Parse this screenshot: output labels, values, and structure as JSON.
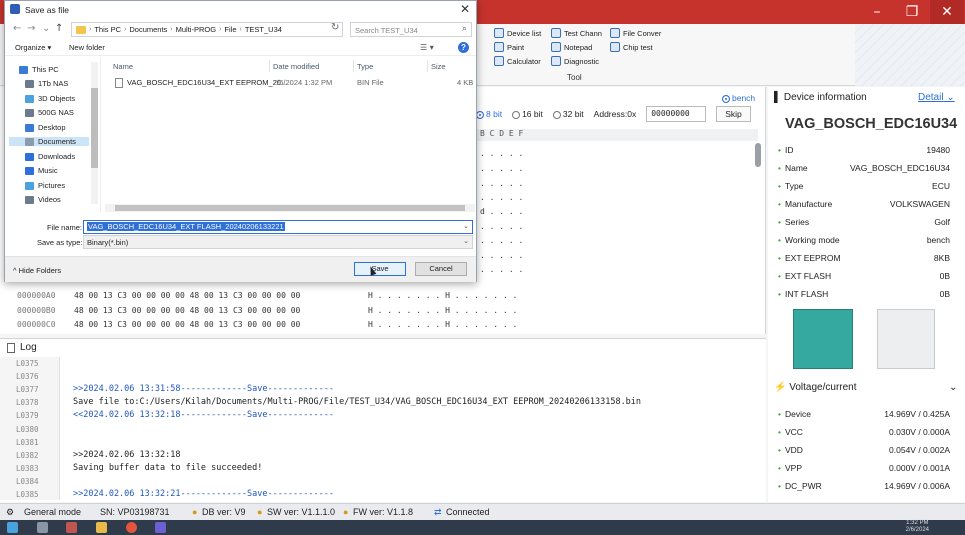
{
  "ribbon": {
    "tools": [
      {
        "label": "Device list"
      },
      {
        "label": "Test Chann"
      },
      {
        "label": "File Conver"
      },
      {
        "label": "Paint"
      },
      {
        "label": "Notepad"
      },
      {
        "label": "Chip test"
      },
      {
        "label": "Calculator"
      },
      {
        "label": "Diagnostic"
      }
    ],
    "group_label": "Tool"
  },
  "hex": {
    "bench_label": "bench",
    "bits": [
      {
        "label": "8 bit",
        "selected": true
      },
      {
        "label": "16 bit",
        "selected": false
      },
      {
        "label": "32 bit",
        "selected": false
      }
    ],
    "address_label": "Address:0x",
    "address_value": "00000000",
    "skip_label": "Skip",
    "header": "B C D E F",
    "partial_rows": [
      ". . . . .",
      ". . . . .",
      ". . . . .",
      ". . . . .",
      "d . . . .",
      ". . . . .",
      ". . . . .",
      ". . . . .",
      ". . . . ."
    ],
    "rows": [
      {
        "addr": "000000A0",
        "bytes": "48 00 13 C3 00 00 00 00 48 00 13 C3 00 00 00 00",
        "ascii": "H . . . . . . . H . . . . . . ."
      },
      {
        "addr": "000000B0",
        "bytes": "48 00 13 C3 00 00 00 00 48 00 13 C3 00 00 00 00",
        "ascii": "H . . . . . . . H . . . . . . ."
      },
      {
        "addr": "000000C0",
        "bytes": "48 00 13 C3 00 00 00 00 48 00 13 C3 00 00 00 00",
        "ascii": "H . . . . . . . H . . . . . . ."
      }
    ]
  },
  "log": {
    "title": "Log",
    "lines": [
      {
        "no": "L0375",
        "text": "",
        "style": ""
      },
      {
        "no": "L0376",
        "text": "",
        "style": ""
      },
      {
        "no": "L0377",
        "text": ">>2024.02.06 13:31:58-------------Save-------------",
        "style": "blue"
      },
      {
        "no": "L0378",
        "text": "Save file to:C:/Users/Kilah/Documents/Multi-PROG/File/TEST_U34/VAG_BOSCH_EDC16U34_EXT EEPROM_20240206133158.bin",
        "style": ""
      },
      {
        "no": "L0379",
        "text": "<<2024.02.06 13:32:18-------------Save-------------",
        "style": "blue"
      },
      {
        "no": "L0380",
        "text": "",
        "style": ""
      },
      {
        "no": "L0381",
        "text": "",
        "style": ""
      },
      {
        "no": "L0382",
        "text": ">>2024.02.06 13:32:18",
        "style": ""
      },
      {
        "no": "L0383",
        "text": "Saving buffer data to file succeeded!",
        "style": ""
      },
      {
        "no": "L0384",
        "text": "",
        "style": ""
      },
      {
        "no": "L0385",
        "text": ">>2024.02.06 13:32:21-------------Save-------------",
        "style": "blue"
      }
    ]
  },
  "device_info": {
    "title": "Device information",
    "detail_label": "Detail",
    "name": "VAG_BOSCH_EDC16U34",
    "fields": [
      {
        "key": "ID",
        "value": "19480"
      },
      {
        "key": "Name",
        "value": "VAG_BOSCH_EDC16U34"
      },
      {
        "key": "Type",
        "value": "ECU"
      },
      {
        "key": "Manufacture",
        "value": "VOLKSWAGEN"
      },
      {
        "key": "Series",
        "value": "Golf"
      },
      {
        "key": "Working mode",
        "value": "bench"
      },
      {
        "key": "EXT EEPROM",
        "value": "8KB"
      },
      {
        "key": "EXT FLASH",
        "value": "0B"
      },
      {
        "key": "INT FLASH",
        "value": "0B"
      }
    ]
  },
  "voltage": {
    "title": "Voltage/current",
    "rows": [
      {
        "key": "Device",
        "value": "14.969V / 0.425A"
      },
      {
        "key": "VCC",
        "value": "0.030V / 0.000A"
      },
      {
        "key": "VDD",
        "value": "0.054V / 0.002A"
      },
      {
        "key": "VPP",
        "value": "0.000V / 0.001A"
      },
      {
        "key": "DC_PWR",
        "value": "14.969V / 0.006A"
      }
    ]
  },
  "status": {
    "mode": "General mode",
    "sn": "SN:  VP03198731",
    "db": "DB ver: V9",
    "sw": "SW ver: V1.1.1.0",
    "fw": "FW ver: V1.1.8",
    "conn": "Connected"
  },
  "taskbar": {
    "time": "1:32 PM",
    "date": "2/6/2024"
  },
  "dialog": {
    "title": "Save as file",
    "breadcrumb": [
      "This PC",
      "Documents",
      "Multi-PROG",
      "File",
      "TEST_U34"
    ],
    "search_placeholder": "Search TEST_U34",
    "organize": "Organize",
    "new_folder": "New folder",
    "nav_items": [
      {
        "label": "This PC",
        "color": "#3a7bd5"
      },
      {
        "label": "1Tb NAS",
        "color": "#6b7b8c"
      },
      {
        "label": "3D Objects",
        "color": "#4aa3df"
      },
      {
        "label": "500G NAS",
        "color": "#6b7b8c"
      },
      {
        "label": "Desktop",
        "color": "#3a7bd5"
      },
      {
        "label": "Documents",
        "color": "#8a9bb0"
      },
      {
        "label": "Downloads",
        "color": "#2f6fd8"
      },
      {
        "label": "Music",
        "color": "#2f6fd8"
      },
      {
        "label": "Pictures",
        "color": "#4aa3df"
      },
      {
        "label": "Videos",
        "color": "#6b7b8c"
      }
    ],
    "columns": [
      "Name",
      "Date modified",
      "Type",
      "Size"
    ],
    "files": [
      {
        "name": "VAG_BOSCH_EDC16U34_EXT EEPROM_20...",
        "date": "2/6/2024 1:32 PM",
        "type": "BIN File",
        "size": "4 KB"
      }
    ],
    "filename_label": "File name:",
    "filename_value": "VAG_BOSCH_EDC16U34_EXT FLASH_20240206133221",
    "filetype_label": "Save as type:",
    "filetype_value": "Binary(*.bin)",
    "hide_folders": "Hide Folders",
    "save": "Save",
    "cancel": "Cancel"
  }
}
